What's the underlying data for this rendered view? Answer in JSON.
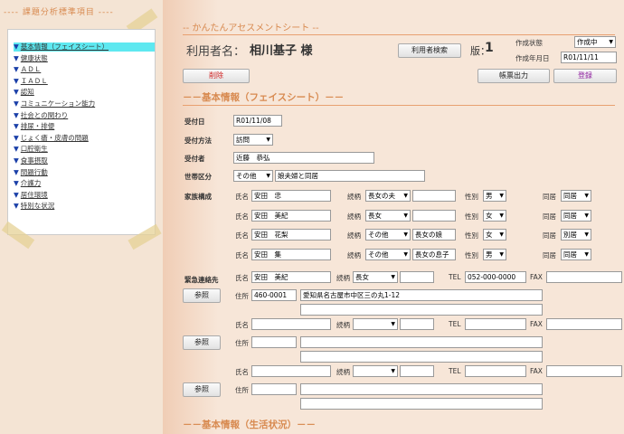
{
  "sidebar": {
    "title": "---- 課題分析標準項目 ----",
    "items": [
      {
        "label": "基本情報（フェイスシート）",
        "active": true
      },
      {
        "label": "健康状態"
      },
      {
        "label": "ＡＤＬ"
      },
      {
        "label": "ＩＡＤＬ"
      },
      {
        "label": "認知"
      },
      {
        "label": "コミュニケーション能力"
      },
      {
        "label": "社会との関わり"
      },
      {
        "label": "排尿・排便"
      },
      {
        "label": "じょく瘡・皮膚の問題"
      },
      {
        "label": "口腔衛生"
      },
      {
        "label": "食事摂取"
      },
      {
        "label": "問題行動"
      },
      {
        "label": "介護力"
      },
      {
        "label": "居住環境"
      },
      {
        "label": "特別な状況"
      }
    ],
    "triangle": "▼"
  },
  "header": {
    "title": "-- かんたんアセスメントシート --",
    "user_label": "利用者名：",
    "user_name": "相川基子 様",
    "search_button": "利用者検索",
    "version_label": "版：",
    "version": "1",
    "status_label": "作成状態",
    "status_value": "作成中",
    "date_label": "作成年月日",
    "date_value": "R01/11/11"
  },
  "toolbar": {
    "delete": "削除",
    "print": "帳票出力",
    "register": "登録"
  },
  "section1": {
    "title": "－－基本情報（フェイスシート）－－",
    "received_date_label": "受付日",
    "received_date": "R01/11/08",
    "method_label": "受付方法",
    "method": "訪問",
    "receiver_label": "受付者",
    "receiver": "近藤　恭弘",
    "household_label": "世帯区分",
    "household_type": "その他",
    "household_note": "娘夫婦と同居",
    "family_label": "家族構成",
    "name_label": "氏名",
    "relation_label": "続柄",
    "gender_label": "性別",
    "living_label": "同居",
    "family": [
      {
        "name": "安田　忠",
        "relation": "長女の夫",
        "relation_note": "",
        "gender": "男",
        "living": "同居"
      },
      {
        "name": "安田　美紀",
        "relation": "長女",
        "relation_note": "",
        "gender": "女",
        "living": "同居"
      },
      {
        "name": "安田　花梨",
        "relation": "その他",
        "relation_note": "長女の娘",
        "gender": "女",
        "living": "別居"
      },
      {
        "name": "安田　集",
        "relation": "その他",
        "relation_note": "長女の息子",
        "gender": "男",
        "living": "同居"
      }
    ],
    "emergency_label": "緊急連絡先",
    "tel_label": "TEL",
    "fax_label": "FAX",
    "address_label": "住所",
    "ref_button": "参照",
    "contacts": [
      {
        "name": "安田　美紀",
        "relation": "長女",
        "relation_note": "",
        "tel": "052-000-0000",
        "fax": "",
        "zip": "460-0001",
        "address": "愛知県名古屋市中区三の丸1-12",
        "address2": ""
      },
      {
        "name": "",
        "relation": "",
        "relation_note": "",
        "tel": "",
        "fax": "",
        "zip": "",
        "address": "",
        "address2": ""
      },
      {
        "name": "",
        "relation": "",
        "relation_note": "",
        "tel": "",
        "fax": "",
        "zip": "",
        "address": "",
        "address2": ""
      }
    ]
  },
  "section2": {
    "title": "－－基本情報（生活状況）－－"
  },
  "colors": {
    "accent": "#d88a50",
    "active_item": "#5ee8f0",
    "link": "#1a3fa8"
  }
}
